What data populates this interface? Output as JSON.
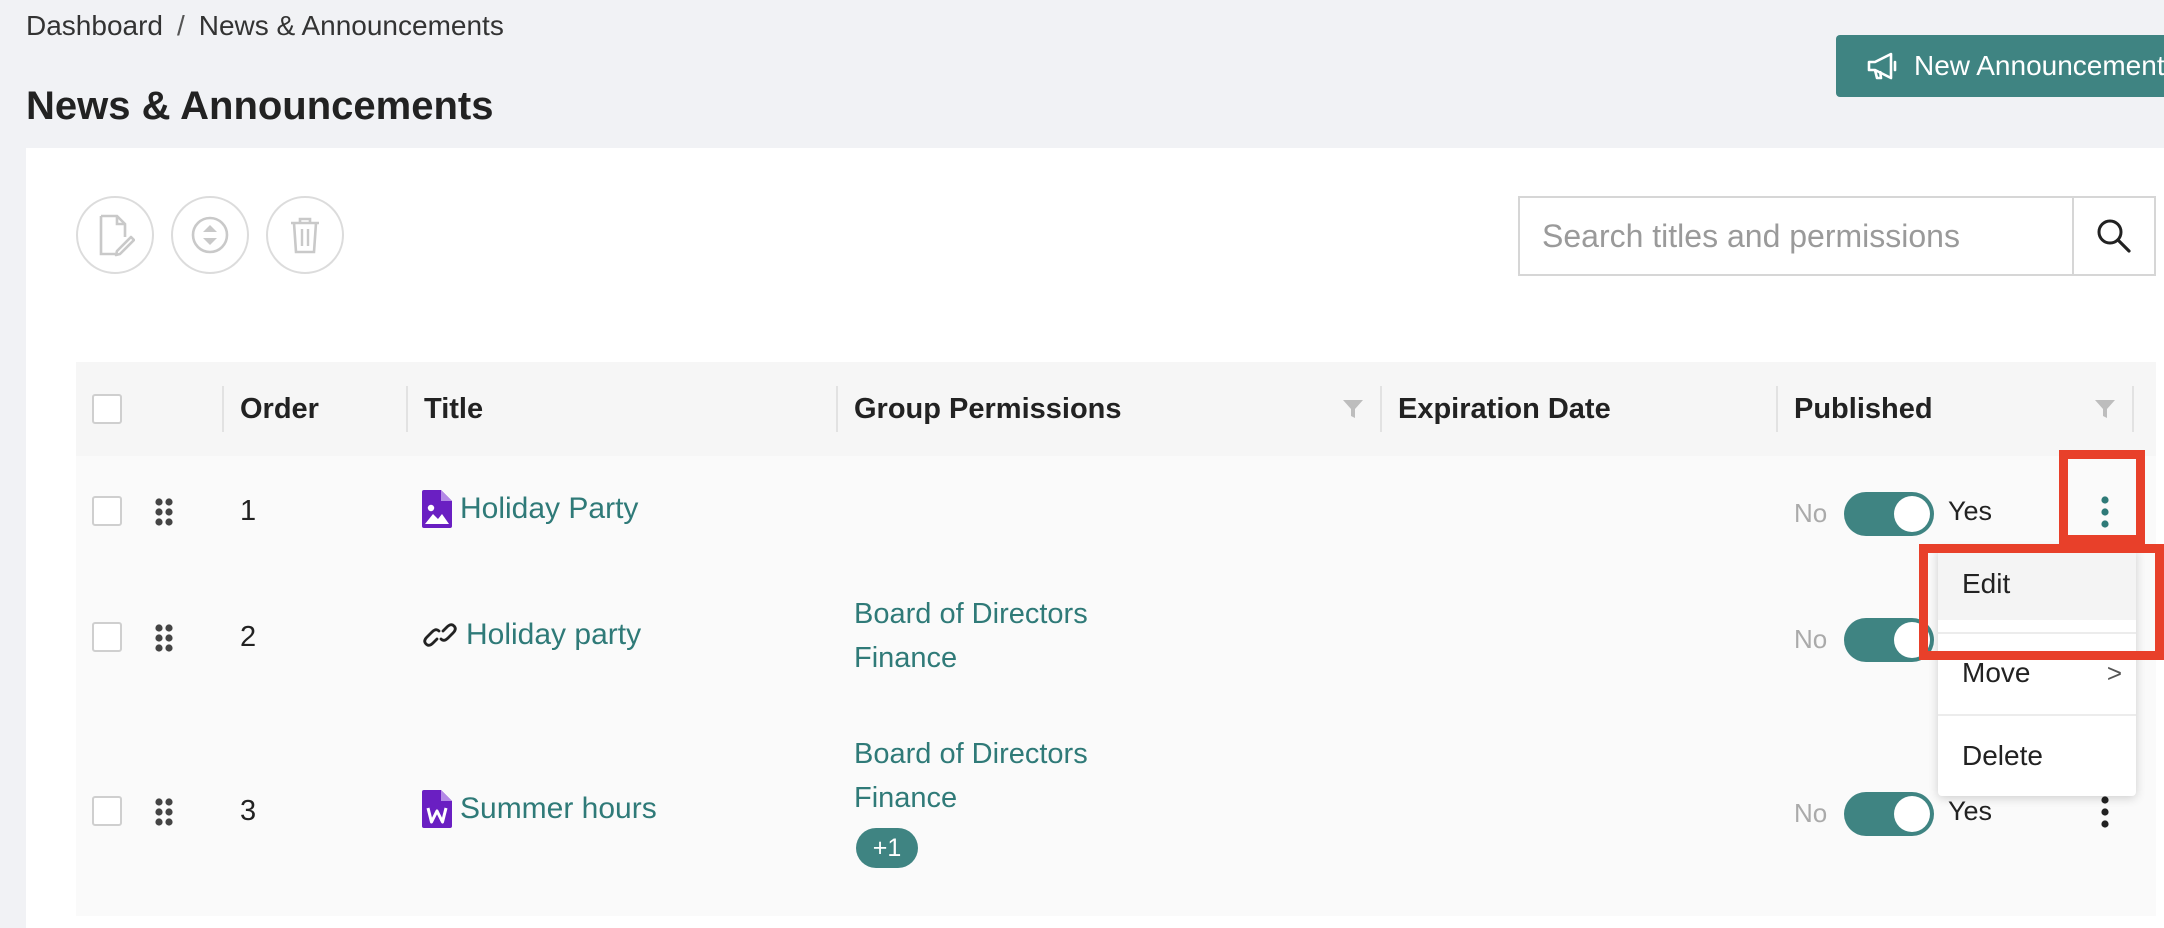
{
  "breadcrumb": {
    "root": "Dashboard",
    "separator": "/",
    "current": "News & Announcements"
  },
  "page": {
    "title": "News & Announcements"
  },
  "actions": {
    "new_label": "New Announcement"
  },
  "search": {
    "placeholder": "Search titles and permissions"
  },
  "table": {
    "columns": [
      "Order",
      "Title",
      "Group Permissions",
      "Expiration Date",
      "Published"
    ],
    "rows": [
      {
        "order": "1",
        "title": "Holiday Party",
        "icon": "image-file-icon",
        "permissions": [],
        "published": true
      },
      {
        "order": "2",
        "title": "Holiday party",
        "icon": "link-icon",
        "permissions": [
          "Board of Directors",
          "Finance"
        ],
        "published": true
      },
      {
        "order": "3",
        "title": "Summer hours",
        "icon": "word-file-icon",
        "permissions": [
          "Board of Directors",
          "Finance"
        ],
        "more_badge": "+1",
        "published": true
      }
    ],
    "toggle_no": "No",
    "toggle_yes": "Yes"
  },
  "context_menu": {
    "items": [
      "Edit",
      "Move",
      "Delete"
    ],
    "submenu_arrow": ">"
  },
  "colors": {
    "accent": "#3f8482",
    "link": "#2f7a78",
    "highlight": "#e8402a",
    "file_icon": "#6a1fc2"
  }
}
